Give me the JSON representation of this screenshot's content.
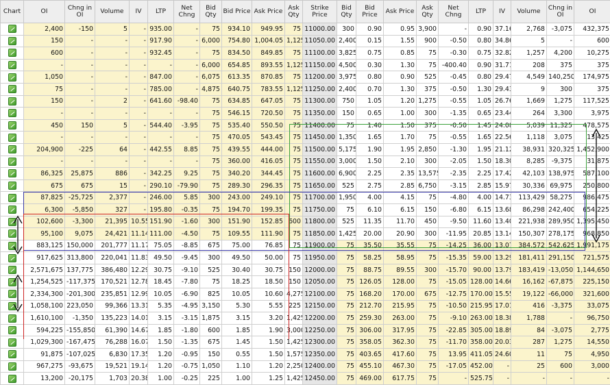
{
  "headers": [
    "Chart",
    "OI",
    "Chng in OI",
    "Volume",
    "IV",
    "LTP",
    "Net Chng",
    "Bid Qty",
    "Bid Price",
    "Ask Price",
    "Ask Qty",
    "Strike Price",
    "Bid Qty",
    "Bid Price",
    "Ask Price",
    "Ask Qty",
    "Net Chng",
    "LTP",
    "IV",
    "Volume",
    "Chng in OI",
    "OI",
    "Chart"
  ],
  "colors": {
    "itm": "#fbf4cc",
    "strike_bg": "#e6e6e6",
    "negative": "#d01818",
    "positive": "#128012",
    "overlay_green": "#3aa03a",
    "overlay_blue": "#3a3aa8",
    "overlay_red": "#cc2222"
  },
  "rows": [
    [
      "2,400",
      "-150",
      "5",
      "-",
      "935.00",
      "-",
      "75",
      "934.10",
      "949.95",
      "75",
      "11000.00",
      "300",
      "0.90",
      "0.95",
      "3,900",
      "-",
      "0.90",
      "37.16",
      "2,768",
      "-3,075",
      "432,375"
    ],
    [
      "150",
      "-",
      "-",
      "-",
      "917.90",
      "-",
      "6,000",
      "754.80",
      "1,004.05",
      "1,125",
      "11050.00",
      "2,400",
      "0.15",
      "1.55",
      "900",
      "-0.50",
      "0.80",
      "34.86",
      "5",
      "-",
      "600"
    ],
    [
      "600",
      "-",
      "-",
      "-",
      "932.45",
      "-",
      "75",
      "834.50",
      "849.85",
      "75",
      "11100.00",
      "3,825",
      "0.75",
      "0.85",
      "75",
      "-0.30",
      "0.75",
      "32.82",
      "1,257",
      "4,200",
      "10,275"
    ],
    [
      "-",
      "-",
      "-",
      "-",
      "-",
      "-",
      "6,000",
      "654.85",
      "893.55",
      "1,125",
      "11150.00",
      "4,500",
      "0.30",
      "1.30",
      "75",
      "-400.40",
      "0.90",
      "31.71",
      "208",
      "375",
      "375"
    ],
    [
      "1,050",
      "-",
      "-",
      "-",
      "847.00",
      "-",
      "6,075",
      "613.35",
      "870.85",
      "75",
      "11200.00",
      "3,975",
      "0.80",
      "0.90",
      "525",
      "-0.45",
      "0.80",
      "29.47",
      "4,549",
      "140,250",
      "174,975"
    ],
    [
      "75",
      "-",
      "-",
      "-",
      "785.00",
      "-",
      "4,875",
      "640.75",
      "783.55",
      "1,125",
      "11250.00",
      "2,400",
      "0.70",
      "1.30",
      "375",
      "-0.50",
      "1.30",
      "29.43",
      "9",
      "300",
      "375"
    ],
    [
      "150",
      "-",
      "2",
      "-",
      "641.60",
      "-98.40",
      "75",
      "634.85",
      "647.05",
      "75",
      "11300.00",
      "750",
      "1.05",
      "1.20",
      "1,275",
      "-0.55",
      "1.05",
      "26.76",
      "1,669",
      "1,275",
      "117,525"
    ],
    [
      "-",
      "-",
      "-",
      "-",
      "-",
      "-",
      "75",
      "546.15",
      "720.50",
      "75",
      "11350.00",
      "150",
      "0.65",
      "1.00",
      "300",
      "-1.35",
      "0.65",
      "23.44",
      "264",
      "3,300",
      "3,975"
    ],
    [
      "450",
      "150",
      "5",
      "-",
      "544.40",
      "-3.95",
      "75",
      "535.40",
      "550.50",
      "75",
      "11400.00",
      "75",
      "1.40",
      "1.50",
      "375",
      "-0.50",
      "1.45",
      "24.08",
      "5,039",
      "11,325",
      "478,575"
    ],
    [
      "-",
      "-",
      "-",
      "-",
      "-",
      "-",
      "75",
      "470.05",
      "543.45",
      "75",
      "11450.00",
      "1,350",
      "1.65",
      "1.70",
      "75",
      "-0.55",
      "1.65",
      "22.56",
      "1,118",
      "3,075",
      "13,425"
    ],
    [
      "204,900",
      "-225",
      "64",
      "-",
      "442.55",
      "8.85",
      "75",
      "439.55",
      "444.00",
      "75",
      "11500.00",
      "5,175",
      "1.90",
      "1.95",
      "2,850",
      "-1.30",
      "1.95",
      "21.12",
      "38,931",
      "320,325",
      "1,452,900"
    ],
    [
      "-",
      "-",
      "-",
      "-",
      "-",
      "-",
      "75",
      "360.00",
      "416.05",
      "75",
      "11550.00",
      "3,000",
      "1.50",
      "2.10",
      "300",
      "-2.05",
      "1.50",
      "18.30",
      "8,285",
      "-9,375",
      "31,875"
    ],
    [
      "86,325",
      "25,875",
      "886",
      "-",
      "342.25",
      "9.25",
      "75",
      "340.20",
      "344.45",
      "75",
      "11600.00",
      "6,900",
      "2.25",
      "2.35",
      "13,575",
      "-2.35",
      "2.25",
      "17.42",
      "42,103",
      "138,975",
      "587,100"
    ],
    [
      "675",
      "675",
      "15",
      "-",
      "290.10",
      "-79.90",
      "75",
      "289.30",
      "296.35",
      "75",
      "11650.00",
      "525",
      "2.75",
      "2.85",
      "6,750",
      "-3.15",
      "2.85",
      "15.97",
      "30,336",
      "69,975",
      "250,800"
    ],
    [
      "87,825",
      "-25,725",
      "2,377",
      "-",
      "246.00",
      "5.85",
      "300",
      "243.00",
      "249.10",
      "75",
      "11700.00",
      "1,950",
      "4.00",
      "4.15",
      "75",
      "-4.80",
      "4.00",
      "14.73",
      "113,429",
      "58,275",
      "986,475"
    ],
    [
      "6,300",
      "-5,850",
      "327",
      "-",
      "195.80",
      "-0.35",
      "75",
      "194.70",
      "199.35",
      "75",
      "11750.00",
      "75",
      "6.10",
      "6.15",
      "150",
      "-6.80",
      "6.15",
      "13.68",
      "86,298",
      "242,400",
      "654,225"
    ],
    [
      "102,600",
      "-3,300",
      "21,395",
      "10.55",
      "151.90",
      "-1.60",
      "300",
      "151.90",
      "152.85",
      "600",
      "11800.00",
      "525",
      "11.35",
      "11.70",
      "450",
      "-9.50",
      "11.60",
      "13.40",
      "221,938",
      "289,950",
      "1,395,450"
    ],
    [
      "95,100",
      "9,075",
      "24,421",
      "11.14",
      "111.00",
      "-4.50",
      "75",
      "109.55",
      "111.90",
      "75",
      "11850.00",
      "1,425",
      "20.00",
      "20.90",
      "300",
      "-11.95",
      "20.85",
      "13.14",
      "150,307",
      "278,175",
      "968,850"
    ],
    [
      "883,125",
      "150,000",
      "201,777",
      "11.17",
      "75.05",
      "-8.85",
      "675",
      "75.00",
      "76.85",
      "75",
      "11900.00",
      "75",
      "35.50",
      "35.55",
      "75",
      "-14.25",
      "36.00",
      "13.07",
      "384,572",
      "542,625",
      "1,991,175"
    ],
    [
      "917,625",
      "313,800",
      "220,041",
      "11.83",
      "49.50",
      "-9.45",
      "300",
      "49.50",
      "50.00",
      "75",
      "11950.00",
      "75",
      "58.25",
      "58.95",
      "75",
      "-15.35",
      "59.00",
      "13.29",
      "181,411",
      "291,150",
      "721,575"
    ],
    [
      "2,571,675",
      "137,775",
      "386,480",
      "12.29",
      "30.75",
      "-9.10",
      "525",
      "30.40",
      "30.75",
      "150",
      "12000.00",
      "75",
      "88.75",
      "89.55",
      "300",
      "-15.70",
      "90.00",
      "13.79",
      "183,419",
      "-13,050",
      "1,144,650"
    ],
    [
      "1,254,525",
      "-117,375",
      "170,521",
      "12.78",
      "18.45",
      "-7.80",
      "75",
      "18.25",
      "18.50",
      "150",
      "12050.00",
      "75",
      "126.05",
      "128.00",
      "75",
      "-15.05",
      "128.00",
      "14.66",
      "16,162",
      "-67,875",
      "225,150"
    ],
    [
      "2,334,300",
      "-201,300",
      "235,851",
      "12.99",
      "10.05",
      "-6.90",
      "825",
      "10.05",
      "10.60",
      "4,275",
      "12100.00",
      "75",
      "168.20",
      "170.00",
      "675",
      "-12.75",
      "170.00",
      "15.55",
      "19,122",
      "-66,000",
      "321,600"
    ],
    [
      "1,058,100",
      "223,050",
      "99,366",
      "13.31",
      "5.35",
      "-4.95",
      "3,150",
      "5.30",
      "5.55",
      "225",
      "12150.00",
      "75",
      "212.70",
      "215.95",
      "75",
      "-10.50",
      "215.95",
      "17.01",
      "416",
      "-3,375",
      "33,075"
    ],
    [
      "1,610,100",
      "-1,350",
      "135,223",
      "14.01",
      "3.15",
      "-3.15",
      "1,875",
      "3.15",
      "3.20",
      "1,425",
      "12200.00",
      "75",
      "259.30",
      "263.00",
      "75",
      "-9.10",
      "263.00",
      "18.38",
      "1,788",
      "-",
      "96,750"
    ],
    [
      "594,225",
      "-155,850",
      "61,390",
      "14.67",
      "1.85",
      "-1.80",
      "600",
      "1.85",
      "1.90",
      "3,000",
      "12250.00",
      "75",
      "306.00",
      "317.95",
      "75",
      "-22.85",
      "305.00",
      "18.89",
      "84",
      "-3,075",
      "2,775"
    ],
    [
      "1,029,300",
      "-167,475",
      "76,288",
      "16.07",
      "1.50",
      "-1.35",
      "675",
      "1.45",
      "1.50",
      "1,425",
      "12300.00",
      "75",
      "358.05",
      "362.30",
      "75",
      "-11.70",
      "358.00",
      "20.03",
      "287",
      "1,275",
      "14,550"
    ],
    [
      "91,875",
      "-107,025",
      "6,830",
      "17.35",
      "1.20",
      "-0.95",
      "150",
      "0.55",
      "1.50",
      "1,575",
      "12350.00",
      "75",
      "403.65",
      "417.60",
      "75",
      "13.95",
      "411.05",
      "24.60",
      "11",
      "75",
      "4,950"
    ],
    [
      "967,275",
      "-93,675",
      "19,521",
      "19.14",
      "1.20",
      "-0.75",
      "1,050",
      "1.10",
      "1.20",
      "2,250",
      "12400.00",
      "75",
      "455.10",
      "467.30",
      "75",
      "-17.05",
      "452.00",
      "-",
      "25",
      "600",
      "3,000"
    ],
    [
      "13,200",
      "-20,175",
      "1,703",
      "20.38",
      "1.00",
      "-0.25",
      "225",
      "1.00",
      "1.25",
      "1,425",
      "12450.00",
      "75",
      "469.00",
      "617.75",
      "75",
      "-",
      "525.75",
      "-",
      "-",
      "-",
      "-"
    ]
  ]
}
